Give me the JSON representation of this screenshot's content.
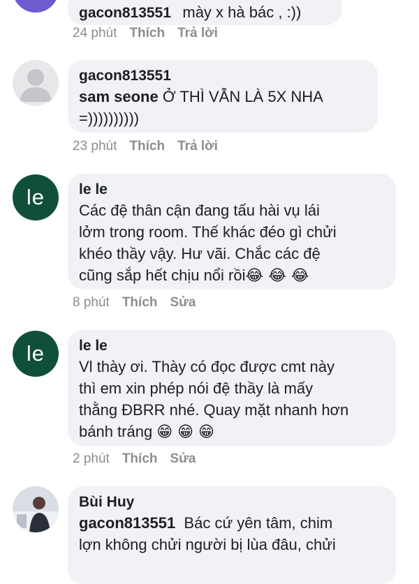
{
  "comments": [
    {
      "author": "gacon813551",
      "text": "mày x hà bác , :))",
      "time": "24 phút",
      "actions": [
        "Thích",
        "Trả lời"
      ]
    },
    {
      "author": "gacon813551",
      "mention": "sam seone",
      "text_line1": " Ở THÌ VẪN LÀ 5X NHA",
      "text_line2": "=))))))))))",
      "time": "23 phút",
      "actions": [
        "Thích",
        "Trả lời"
      ]
    },
    {
      "avatar_text": "le",
      "author": "le le",
      "lines": [
        "Các đệ thân cận đang tấu hài vụ lái",
        "lởm trong room. Thế khác đéo gì chửi",
        "khéo thầy vậy. Hư vãi. Chắc các đệ",
        "cũng sắp hết chịu nổi rồi"
      ],
      "emojis": "😂 😂 😂",
      "time": "8 phút",
      "actions": [
        "Thích",
        "Sửa"
      ]
    },
    {
      "avatar_text": "le",
      "author": "le le",
      "lines": [
        "Vl thày ơi. Thày có đọc được cmt này",
        "thì em xin phép nói đệ thầy là mấy",
        "thằng ĐBRR nhé. Quay mặt nhanh hơn",
        "bánh tráng"
      ],
      "emojis": "😁 😁 😁",
      "time": "2 phút",
      "actions": [
        "Thích",
        "Sửa"
      ]
    },
    {
      "author": "Bùi Huy",
      "mention": "gacon813551",
      "line1": "  Bác cứ yên tâm, chim",
      "line2": "lợn không chửi người bị lùa đâu, chửi"
    }
  ],
  "colors": {
    "bubble": "#f0f2f5",
    "meta": "#8a8d91",
    "le_avatar": "#0f4f3c"
  }
}
